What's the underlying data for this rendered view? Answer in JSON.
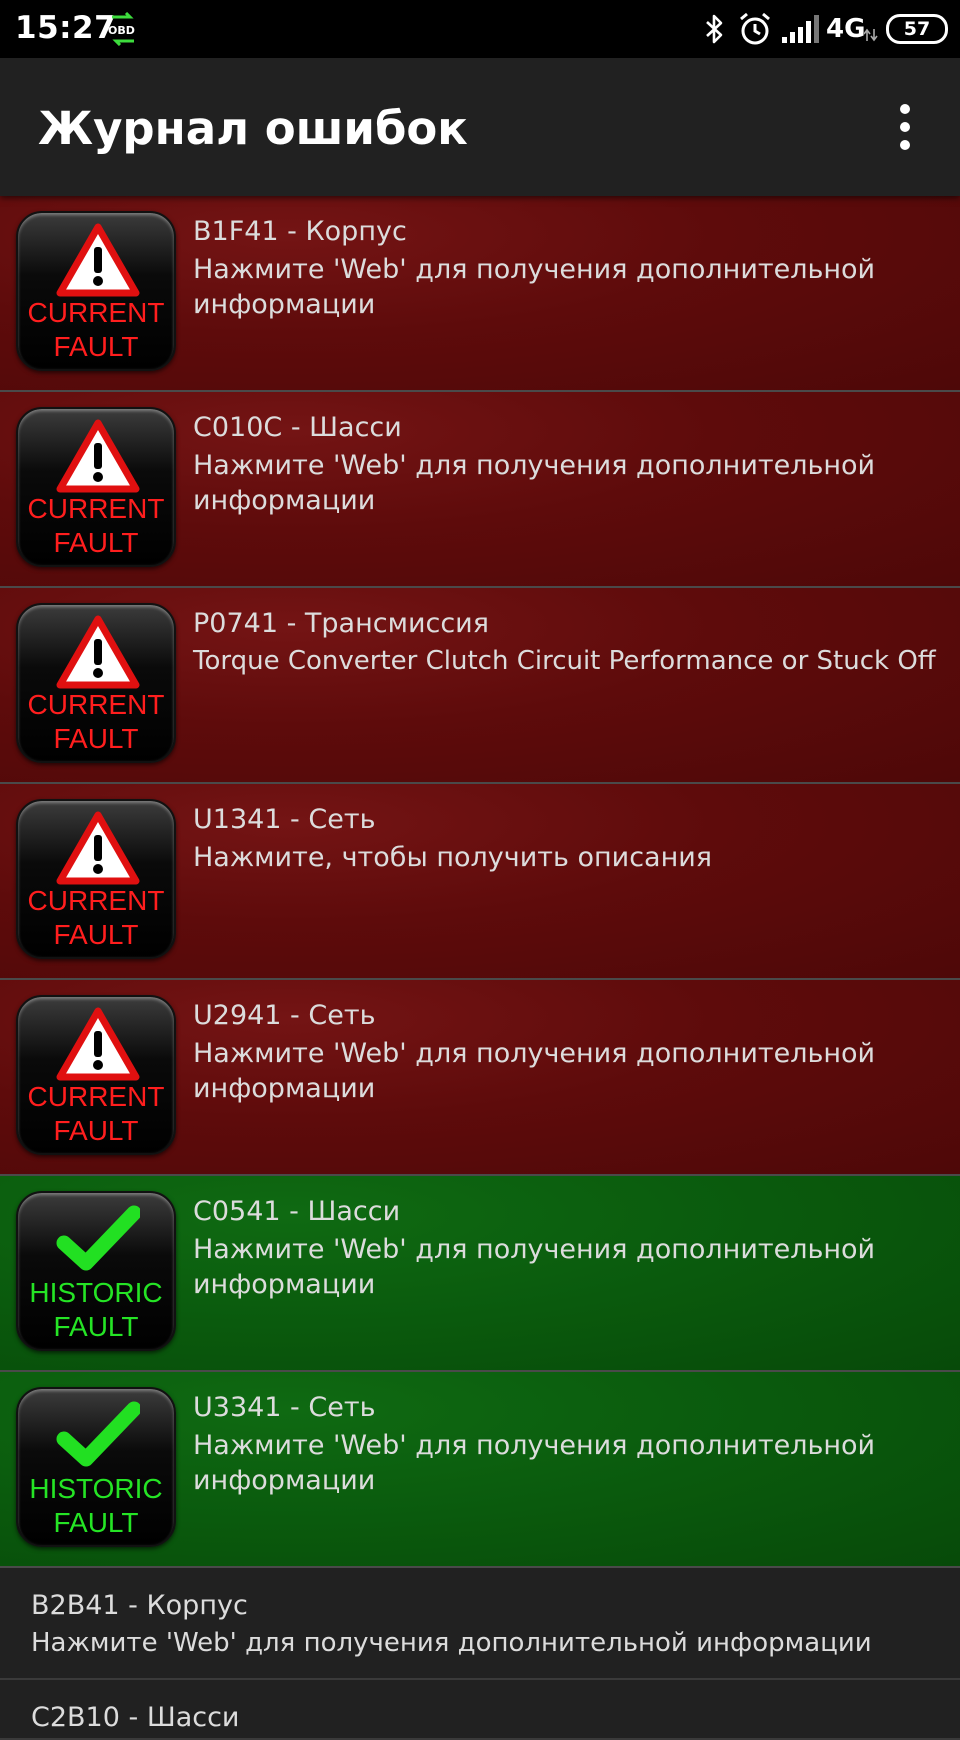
{
  "status_bar": {
    "time": "15:27",
    "obd_label": "OBD",
    "network": "4G",
    "battery": "57",
    "icons": [
      "bluetooth-icon",
      "alarm-icon",
      "signal-icon"
    ]
  },
  "app_bar": {
    "title": "Журнал ошибок",
    "menu_icon": "overflow-menu-icon"
  },
  "colors": {
    "current_fault_bg": "#5e0b0b",
    "historic_fault_bg": "#0a5a0d",
    "current_label": "#ff1e1e",
    "historic_label": "#25e425"
  },
  "faults": [
    {
      "type": "current",
      "badge_line1": "CURRENT",
      "badge_line2": "FAULT",
      "code": "B1F41 - Корпус",
      "desc": "Нажмите 'Web' для получения дополнительной информации"
    },
    {
      "type": "current",
      "badge_line1": "CURRENT",
      "badge_line2": "FAULT",
      "code": "C010C - Шасси",
      "desc": "Нажмите 'Web' для получения дополнительной информации"
    },
    {
      "type": "current",
      "badge_line1": "CURRENT",
      "badge_line2": "FAULT",
      "code": "P0741 - Трансмиссия",
      "desc": "Torque Converter Clutch Circuit Performance or Stuck Off"
    },
    {
      "type": "current",
      "badge_line1": "CURRENT",
      "badge_line2": "FAULT",
      "code": "U1341 - Сеть",
      "desc": "Нажмите, чтобы получить описания"
    },
    {
      "type": "current",
      "badge_line1": "CURRENT",
      "badge_line2": "FAULT",
      "code": "U2941 - Сеть",
      "desc": "Нажмите 'Web' для получения дополнительной информации"
    },
    {
      "type": "historic",
      "badge_line1": "HISTORIC",
      "badge_line2": "FAULT",
      "code": "C0541 - Шасси",
      "desc": "Нажмите 'Web' для получения дополнительной информации"
    },
    {
      "type": "historic",
      "badge_line1": "HISTORIC",
      "badge_line2": "FAULT",
      "code": "U3341 - Сеть",
      "desc": "Нажмите 'Web' для получения дополнительной информации"
    }
  ],
  "plain_faults": [
    {
      "code": "B2B41 - Корпус",
      "desc": "Нажмите 'Web' для получения дополнительной информации"
    },
    {
      "code": "C2B10 - Шасси",
      "desc": ""
    }
  ]
}
